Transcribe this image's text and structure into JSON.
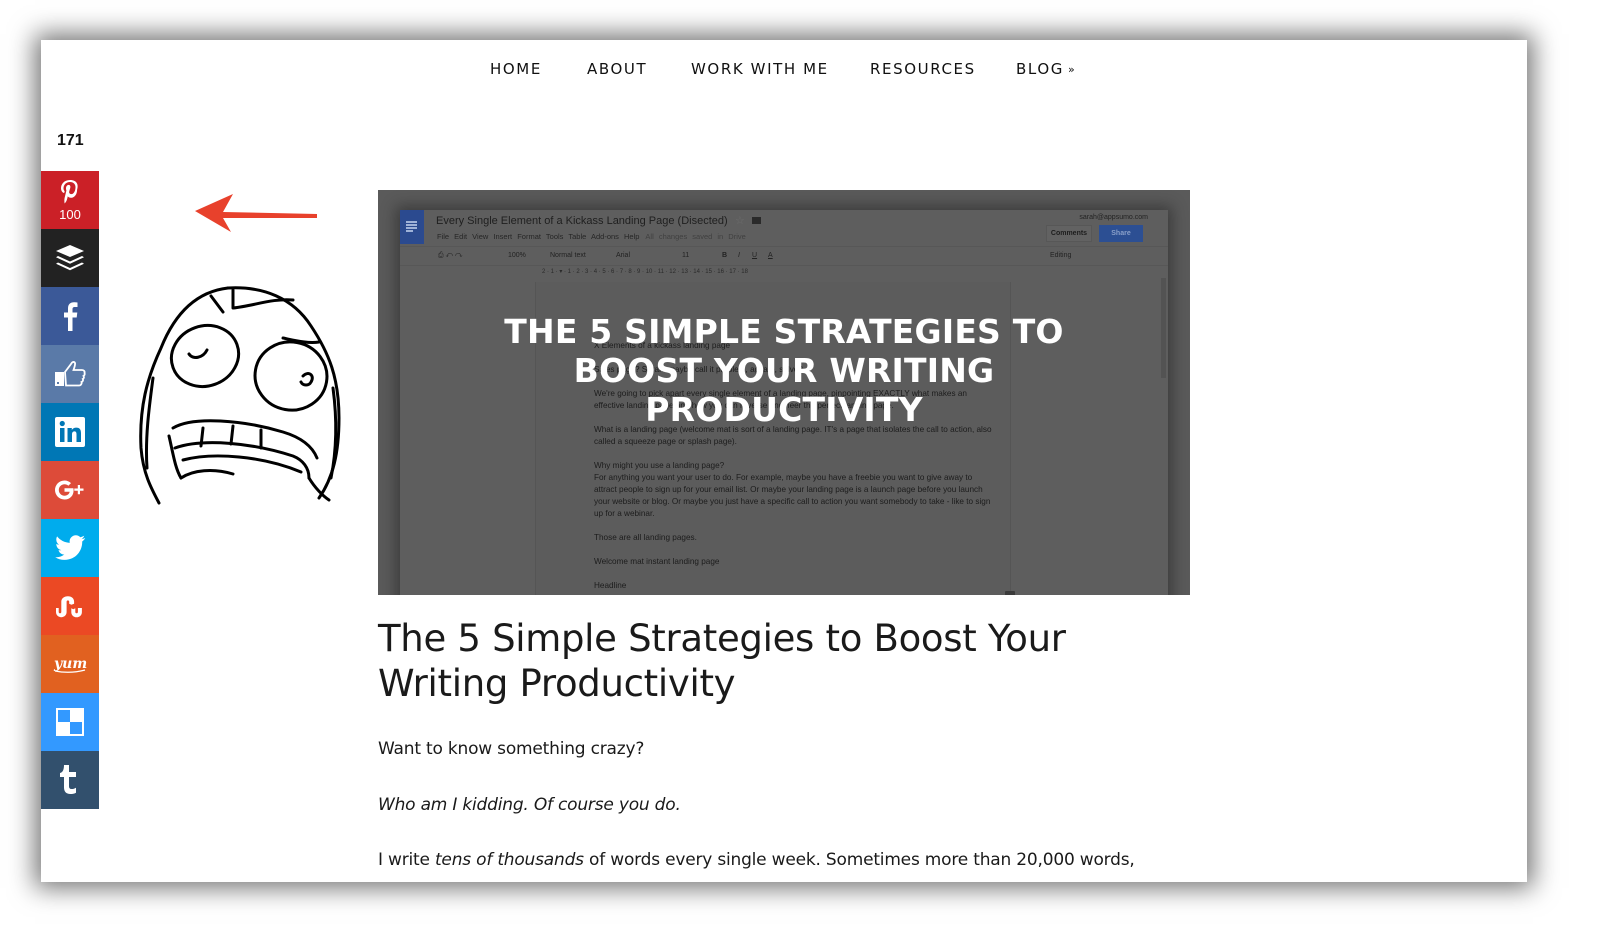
{
  "nav": {
    "items": [
      {
        "label": "HOME"
      },
      {
        "label": "ABOUT"
      },
      {
        "label": "WORK WITH ME"
      },
      {
        "label": "RESOURCES"
      },
      {
        "label": "BLOG",
        "chevron": "»"
      }
    ]
  },
  "share": {
    "total": "171",
    "buttons": [
      {
        "network": "pinterest",
        "icon": "pinterest-icon",
        "count": "100",
        "color": "#cb2027"
      },
      {
        "network": "buffer",
        "icon": "buffer-icon",
        "color": "#222222"
      },
      {
        "network": "facebook",
        "icon": "facebook-icon",
        "color": "#3b5998"
      },
      {
        "network": "facebook-like",
        "icon": "thumbs-up-icon",
        "color": "#5a7aa8"
      },
      {
        "network": "linkedin",
        "icon": "linkedin-icon",
        "color": "#0077b5"
      },
      {
        "network": "google-plus",
        "icon": "google-plus-icon",
        "color": "#dd4b39"
      },
      {
        "network": "twitter",
        "icon": "twitter-icon",
        "color": "#00aced"
      },
      {
        "network": "stumbleupon",
        "icon": "stumbleupon-icon",
        "color": "#eb4924"
      },
      {
        "network": "yummly",
        "icon": "yummly-icon",
        "color": "#e16120"
      },
      {
        "network": "delicious",
        "icon": "delicious-icon",
        "color": "#3399ff"
      },
      {
        "network": "tumblr",
        "icon": "tumblr-icon",
        "color": "#32506d"
      }
    ]
  },
  "annotation": {
    "arrow_color": "#e8412c"
  },
  "hero": {
    "overlay_title": "THE 5 SIMPLE STRATEGIES TO BOOST YOUR WRITING PRODUCTIVITY",
    "gdoc": {
      "title": "Every Single Element of a Kickass Landing Page (Disected)",
      "menu": "File Edit View Insert Format Tools Table Add-ons Help",
      "saved_status": "All changes saved in Drive",
      "user": "sarah@appsumo.com",
      "comments_label": "Comments",
      "share_label": "Share",
      "zoom": "100%",
      "style": "Normal text",
      "font": "Arial",
      "size": "11",
      "mode": "Editing",
      "ruler": "2 · 1 · ▾ · 1 · 2 · 3 · 4 · 5 · 6 · 7 · 8 · 9 · 10 · 11 · 12 · 13 · 14 · 15 · 16 · 17 · 18",
      "body": [
        "X Elements of a kickass landing page",
        "Sales page? Sarah: maybe call it problem, agitate, solve?",
        "We're going to pick apart every single element of a landing page, pinpointing EXACTLY what makes an effective landing page and how you can reverse engineer the perfect landing page.",
        "What is a landing page (welcome mat is sort of a landing page. IT's a page that isolates the call to action, also called a squeeze page or splash page).",
        "Why might you use a landing page?\nFor anything you want your user to do. For example, maybe you have a freebie you want to give away to attract people to sign up for your email list. Or maybe your landing page is a launch page before you launch your website or blog. Or maybe you just have a specific call to action you want somebody to take - like to sign up for a webinar.",
        "Those are all landing pages.",
        "Welcome mat instant landing page",
        "Headline"
      ]
    }
  },
  "article": {
    "title": "The 5 Simple Strategies to Boost Your Writing Productivity",
    "p1": "Want to know something crazy?",
    "p2": "Who am I kidding. Of course you do.",
    "p3_a": "I write ",
    "p3_em": "tens of thousands",
    "p3_b": " of words every single week. Sometimes more than 20,000 words,"
  }
}
